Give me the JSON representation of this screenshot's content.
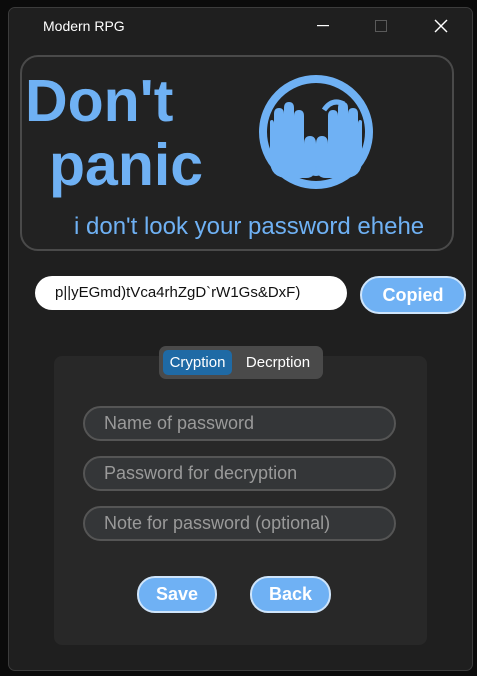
{
  "window": {
    "title": "Modern RPG"
  },
  "banner": {
    "line1": "Don't",
    "line2": "panic",
    "subtitle": "i don't look your password ehehe",
    "icon": "face-covering-eyes-icon"
  },
  "password": {
    "value": "p||yEGmd)tVca4rhZgD`rW1Gs&DxF)",
    "copy_label": "Copied"
  },
  "tabs": [
    {
      "label": "Cryption",
      "active": true
    },
    {
      "label": "Decrption",
      "active": false
    }
  ],
  "form": {
    "name_placeholder": "Name of password",
    "decryption_placeholder": "Password for decryption",
    "note_placeholder": "Note for password (optional)"
  },
  "actions": {
    "save_label": "Save",
    "back_label": "Back"
  },
  "colors": {
    "accent": "#6fb1f4",
    "tab_active": "#1f6aa5",
    "background": "#1f1f1f"
  }
}
